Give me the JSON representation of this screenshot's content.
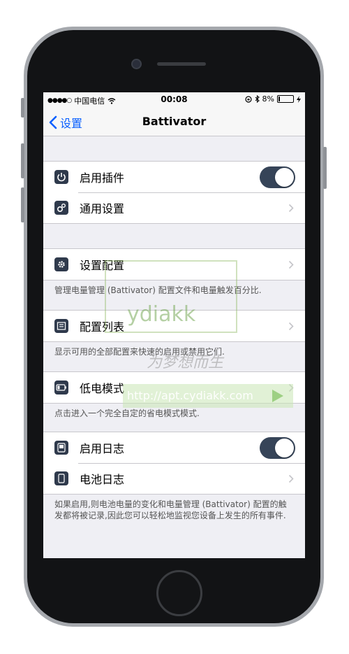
{
  "statusbar": {
    "carrier": "中国电信",
    "time": "00:08",
    "battery_percent": "8%",
    "battery_level": 0.08
  },
  "nav": {
    "back_label": "设置",
    "title": "Battivator"
  },
  "groups": [
    {
      "cells": [
        {
          "label": "启用插件",
          "icon": "power-icon",
          "accessory": "toggle",
          "on": true
        },
        {
          "label": "通用设置",
          "icon": "gears-icon",
          "accessory": "chevron"
        }
      ]
    },
    {
      "cells": [
        {
          "label": "设置配置",
          "icon": "gear-icon",
          "accessory": "chevron"
        }
      ],
      "footer": "管理电量管理 (Battivator) 配置文件和电量触发百分比."
    },
    {
      "cells": [
        {
          "label": "配置列表",
          "icon": "list-icon",
          "accessory": "chevron"
        }
      ],
      "footer": "显示可用的全部配置来快速的启用或禁用它们."
    },
    {
      "cells": [
        {
          "label": "低电模式",
          "icon": "low-battery-icon",
          "accessory": "chevron"
        }
      ],
      "footer": "点击进入一个完全自定的省电模式模式."
    },
    {
      "cells": [
        {
          "label": "启用日志",
          "icon": "log-icon",
          "accessory": "toggle",
          "on": true
        },
        {
          "label": "电池日志",
          "icon": "battery-log-icon",
          "accessory": "chevron"
        }
      ],
      "footer": "如果启用,则电池电量的变化和电量管理 (Battivator) 配置的触发都将被记录,因此您可以轻松地监视您设备上发生的所有事件."
    }
  ],
  "watermark": {
    "brand": "ydiakk",
    "slogan": "为梦想而生",
    "url": "http://apt.cydiakk.com"
  }
}
